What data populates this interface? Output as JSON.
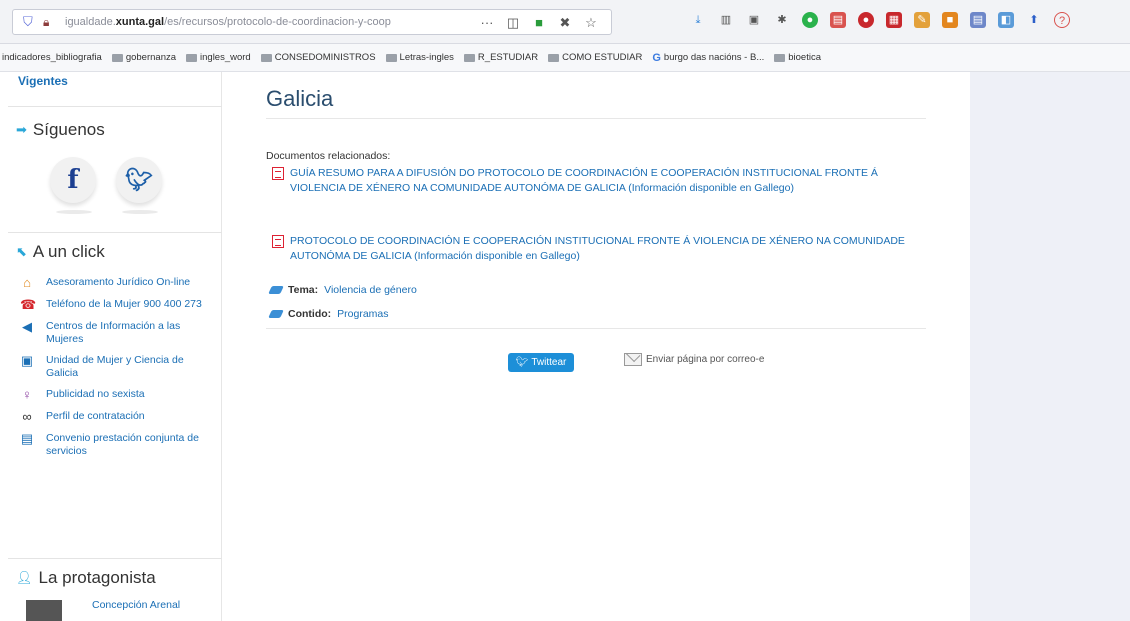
{
  "browser": {
    "url_prefix": "igualdade.",
    "url_domain": "xunta.gal",
    "url_path": "/es/recursos/protocolo-de-coordinacion-y-coop",
    "overflow_menu": "···"
  },
  "bookmarks": [
    "indicadores_bibliografia",
    "gobernanza",
    "ingles_word",
    "CONSEDOMINISTROS",
    "Letras-ingles",
    "R_ESTUDIAR",
    "COMO ESTUDIAR",
    "burgo das nacións - B...",
    "bioetica"
  ],
  "sidebar": {
    "vigentes": "Vigentes",
    "siguenos_title": "Síguenos",
    "aclick_title": "A un click",
    "aclick_items": [
      {
        "label": "Asesoramento Jurídico On-line",
        "icon": "legal-advice-icon",
        "color": "#e08a1e"
      },
      {
        "label": "Teléfono de la Mujer 900 400 273",
        "icon": "phone-icon",
        "color": "#d4262c"
      },
      {
        "label": "Centros de Información a las Mujeres",
        "icon": "megaphone-icon",
        "color": "#1b6fb5"
      },
      {
        "label": "Unidad de Mujer y Ciencia de Galicia",
        "icon": "flask-icon",
        "color": "#1b6fb5"
      },
      {
        "label": "Publicidad no sexista",
        "icon": "female-symbol-icon",
        "color": "#8b3fa0"
      },
      {
        "label": "Perfil de contratación",
        "icon": "link-icon",
        "color": "#333333"
      },
      {
        "label": "Convenio prestación conjunta de servicios",
        "icon": "document-icon",
        "color": "#1b6fb5"
      }
    ],
    "protagonista_title": "La protagonista",
    "protagonista_name": "Concepción Arenal"
  },
  "main": {
    "title": "Galicia",
    "docs_label": "Documentos relacionados:",
    "documents": [
      "GUÍA RESUMO PARA A DIFUSIÓN DO PROTOCOLO DE COORDINACIÓN E COOPERACIÓN INSTITUCIONAL FRONTE Á VIOLENCIA DE XÉNERO NA COMUNIDADE AUTONÓMA DE GALICIA (Información disponible en Gallego)",
      "PROTOCOLO DE COORDINACIÓN E COOPERACIÓN INSTITUCIONAL FRONTE Á VIOLENCIA DE XÉNERO NA COMUNIDADE AUTONÓMA DE GALICIA (Información disponible en Gallego)"
    ],
    "tema_key": "Tema:",
    "tema_value": "Violencia de género",
    "contido_key": "Contido:",
    "contido_value": "Programas",
    "twittear": "Twittear",
    "email": "Enviar página por correo-e"
  },
  "colors": {
    "link": "#1b6fb5",
    "twitter_button": "#1d8fd8",
    "accent_arrow": "#2aa7d8"
  }
}
